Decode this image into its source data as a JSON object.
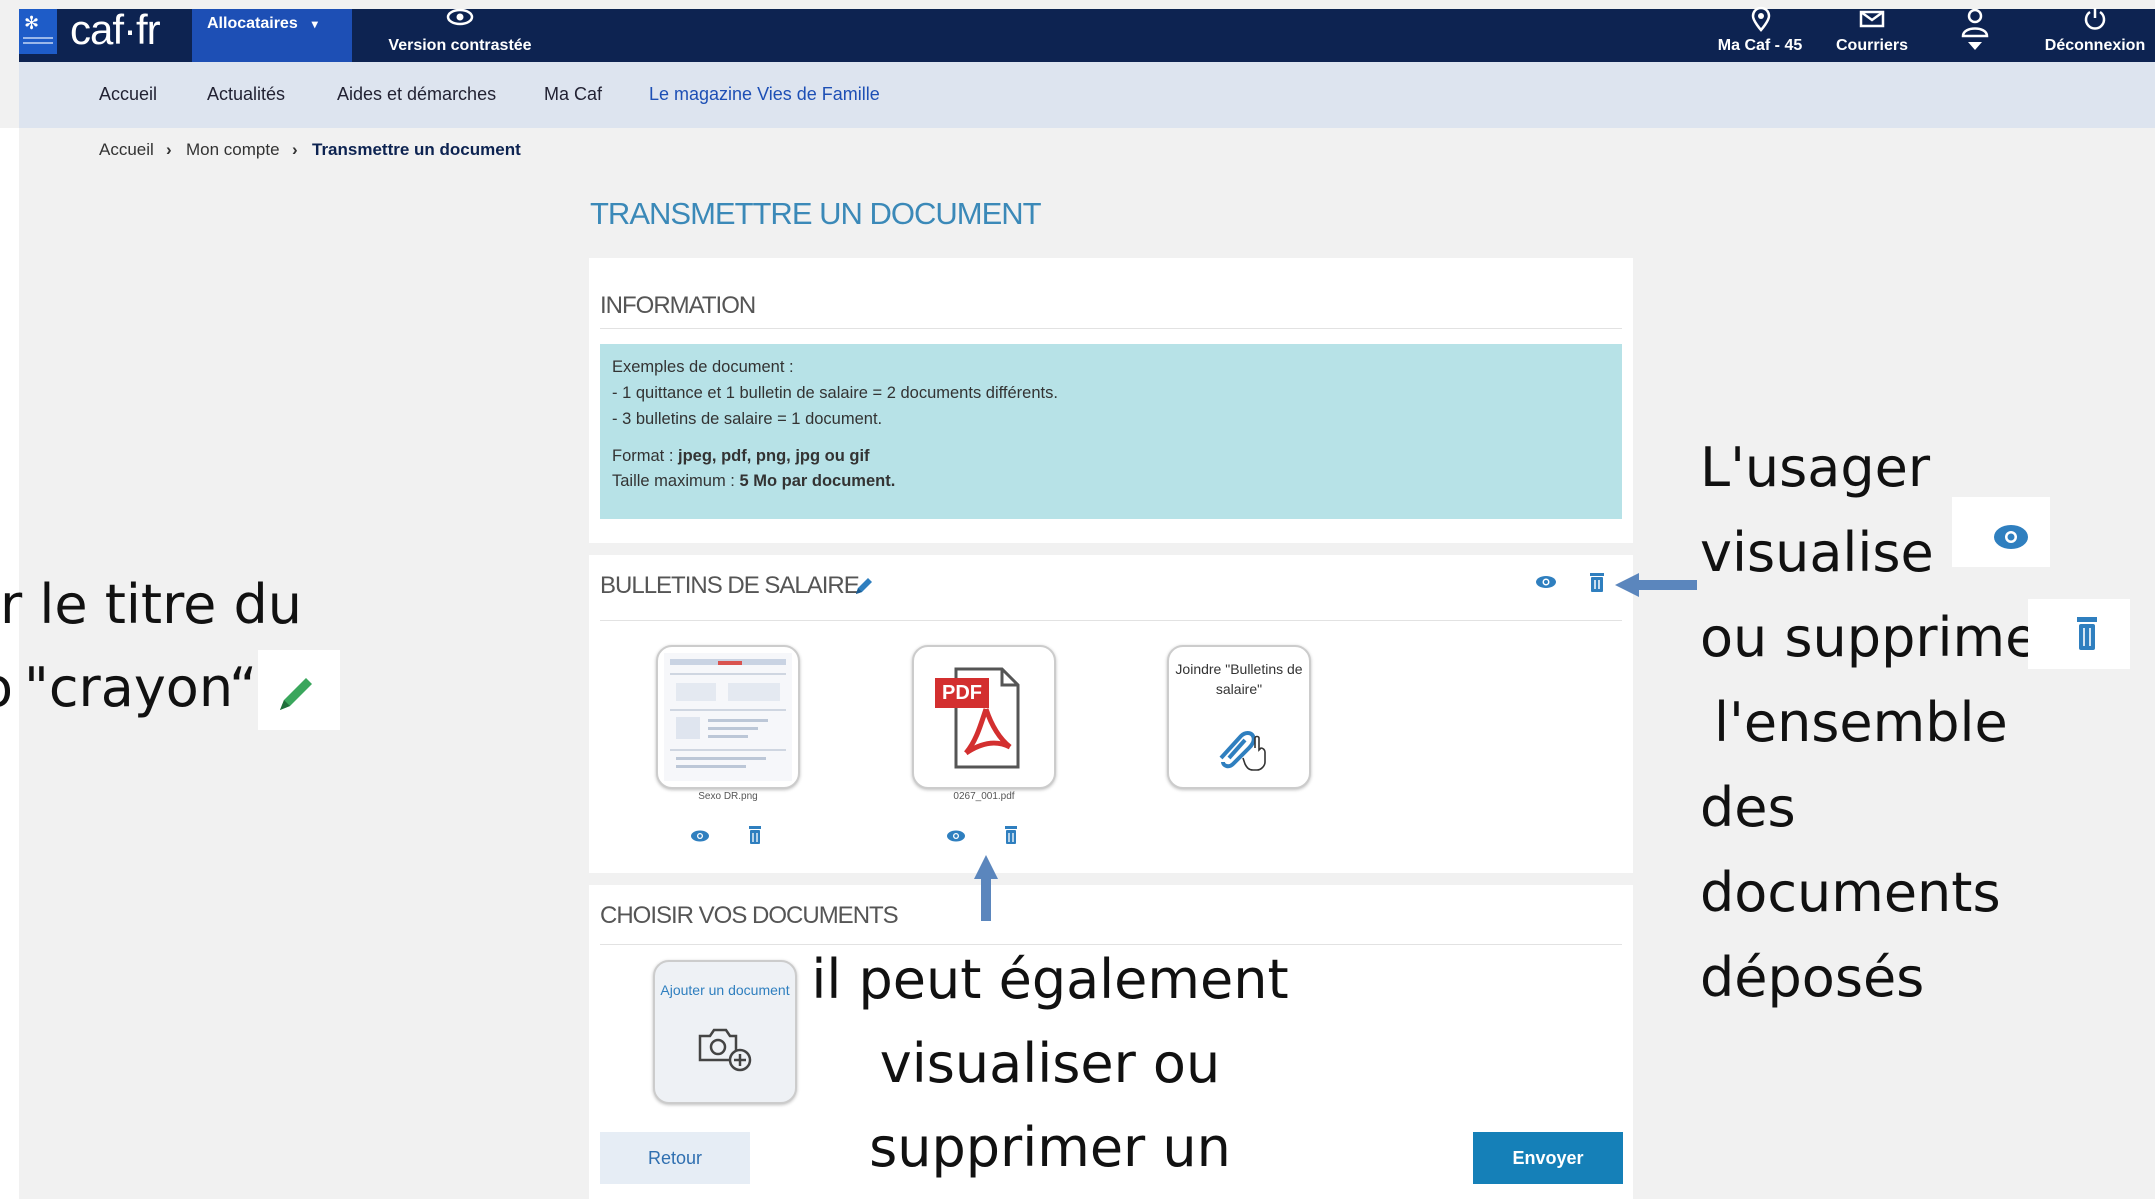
{
  "header": {
    "logo": "caf·fr",
    "allocataires": "Allocataires",
    "version_contrastee": "Version contrastée",
    "ma_caf": "Ma Caf - 45",
    "courriers": "Courriers",
    "deconnexion": "Déconnexion"
  },
  "nav": {
    "items": [
      "Accueil",
      "Actualités",
      "Aides et démarches",
      "Ma Caf",
      "Le magazine Vies de Famille"
    ]
  },
  "breadcrumb": [
    "Accueil",
    "Mon compte",
    "Transmettre un document"
  ],
  "page_title": "TRANSMETTRE UN DOCUMENT",
  "information": {
    "title": "INFORMATION",
    "examples_label": "Exemples de document :",
    "example_1": "- 1 quittance et 1 bulletin de salaire = 2 documents différents.",
    "example_2": "- 3 bulletins de salaire = 1 document.",
    "format_label": "Format : ",
    "format_value": "jpeg, pdf, png, jpg ou gif",
    "size_label": "Taille maximum : ",
    "size_value": "5 Mo par document."
  },
  "bulletins": {
    "title": "BULLETINS DE SALAIRE",
    "files": [
      {
        "caption": "Sexo DR.png"
      },
      {
        "caption": "0267_001.pdf",
        "badge": "PDF"
      }
    ],
    "join_label": "Joindre \"Bulletins de salaire\""
  },
  "choose": {
    "title": "CHOISIR VOS DOCUMENTS",
    "add_label": "Ajouter un document"
  },
  "buttons": {
    "retour": "Retour",
    "envoyer": "Envoyer"
  },
  "annotations": {
    "left_line1": "r le titre du",
    "left_line2": "\"crayon“",
    "right_lines": [
      "L'usager",
      "visualise",
      "ou supprime",
      "l'ensemble",
      "des",
      "documents",
      "déposés"
    ],
    "bottom_lines": [
      "il peut également",
      "visualiser ou",
      "supprimer un"
    ]
  },
  "colors": {
    "topbar": "#0d2351",
    "accent": "#1d4fb5",
    "title": "#3b89b8",
    "info_bg": "#b7e2e7",
    "envoyer": "#1580b8",
    "arrow": "#5b86bd"
  }
}
